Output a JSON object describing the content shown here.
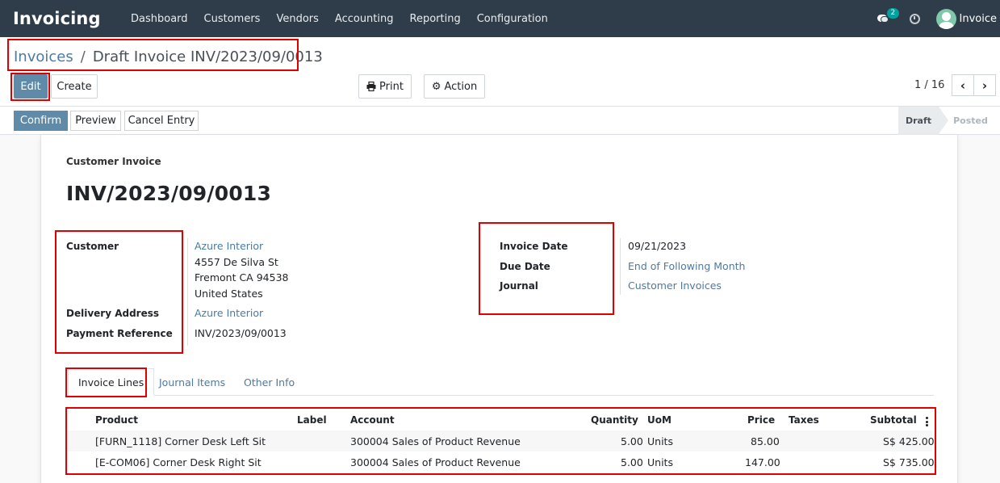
{
  "navbar": {
    "brand": "Invoicing",
    "menu": [
      "Dashboard",
      "Customers",
      "Vendors",
      "Accounting",
      "Reporting",
      "Configuration"
    ],
    "chat_badge": "2",
    "user_name": "Invoice"
  },
  "breadcrumb": {
    "parent": "Invoices",
    "separator": "/",
    "current": "Draft Invoice INV/2023/09/0013"
  },
  "toolbar": {
    "edit": "Edit",
    "create": "Create",
    "print": "Print",
    "action": "Action",
    "pager": "1 / 16"
  },
  "statusbar": {
    "confirm": "Confirm",
    "preview": "Preview",
    "cancel_entry": "Cancel Entry",
    "stage_draft": "Draft",
    "stage_posted": "Posted"
  },
  "form": {
    "type_label": "Customer Invoice",
    "number": "INV/2023/09/0013",
    "customer_label": "Customer",
    "customer_name": "Azure Interior",
    "address_line1": "4557 De Silva St",
    "address_line2": "Fremont CA 94538",
    "address_line3": "United States",
    "delivery_label": "Delivery Address",
    "delivery_value": "Azure Interior",
    "payment_ref_label": "Payment Reference",
    "payment_ref_value": "INV/2023/09/0013",
    "invoice_date_label": "Invoice Date",
    "invoice_date_value": "09/21/2023",
    "due_date_label": "Due Date",
    "due_date_value": "End of Following Month",
    "journal_label": "Journal",
    "journal_value": "Customer Invoices"
  },
  "tabs": [
    "Invoice Lines",
    "Journal Items",
    "Other Info"
  ],
  "lines": {
    "headers": {
      "product": "Product",
      "label": "Label",
      "account": "Account",
      "quantity": "Quantity",
      "uom": "UoM",
      "price": "Price",
      "taxes": "Taxes",
      "subtotal": "Subtotal"
    },
    "rows": [
      {
        "product": "[FURN_1118] Corner Desk Left Sit",
        "label": "",
        "account": "300004 Sales of Product Revenue",
        "quantity": "5.00",
        "uom": "Units",
        "price": "85.00",
        "taxes": "",
        "subtotal": "S$ 425.00"
      },
      {
        "product": "[E-COM06] Corner Desk Right Sit",
        "label": "",
        "account": "300004 Sales of Product Revenue",
        "quantity": "5.00",
        "uom": "Units",
        "price": "147.00",
        "taxes": "",
        "subtotal": "S$ 735.00"
      }
    ]
  },
  "colors": {
    "navbar_bg": "#2f3c4a",
    "primary": "#5f8ba9",
    "link": "#4c7aa3",
    "annotation": "#e00000"
  }
}
